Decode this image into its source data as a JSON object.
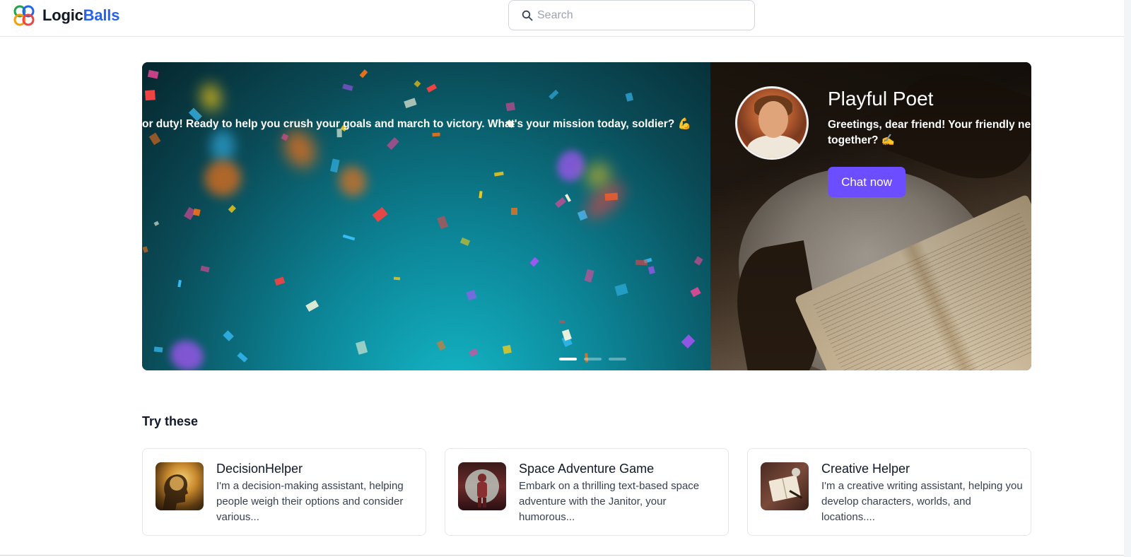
{
  "header": {
    "logo_part1": "Logic",
    "logo_part2": "Balls",
    "search_placeholder": "Search"
  },
  "hero": {
    "previous_slide_text": "or duty! Ready to help you crush your goals and march to victory. What's your mission today, soldier? 💪",
    "title": "Playful Poet",
    "description_line1": "Greetings, dear friend! Your friendly neig",
    "description_line2": "together? ✍️",
    "cta_label": "Chat now",
    "slides_total": 3,
    "active_slide": 1
  },
  "try_these": {
    "heading": "Try these",
    "cards": [
      {
        "title": "DecisionHelper",
        "description": "I'm a decision-making assistant, helping people weigh their options and consider various..."
      },
      {
        "title": "Space Adventure Game",
        "description": "Embark on a thrilling text-based space adventure with the Janitor, your humorous..."
      },
      {
        "title": "Creative Helper",
        "description": "I'm a creative writing assistant, helping you develop characters, worlds, and locations...."
      }
    ]
  },
  "colors": {
    "brand_blue": "#2563eb",
    "cta_purple": "#6c4dff"
  },
  "icons": {
    "logo": "logicballs-logo-icon",
    "search": "search-icon"
  }
}
